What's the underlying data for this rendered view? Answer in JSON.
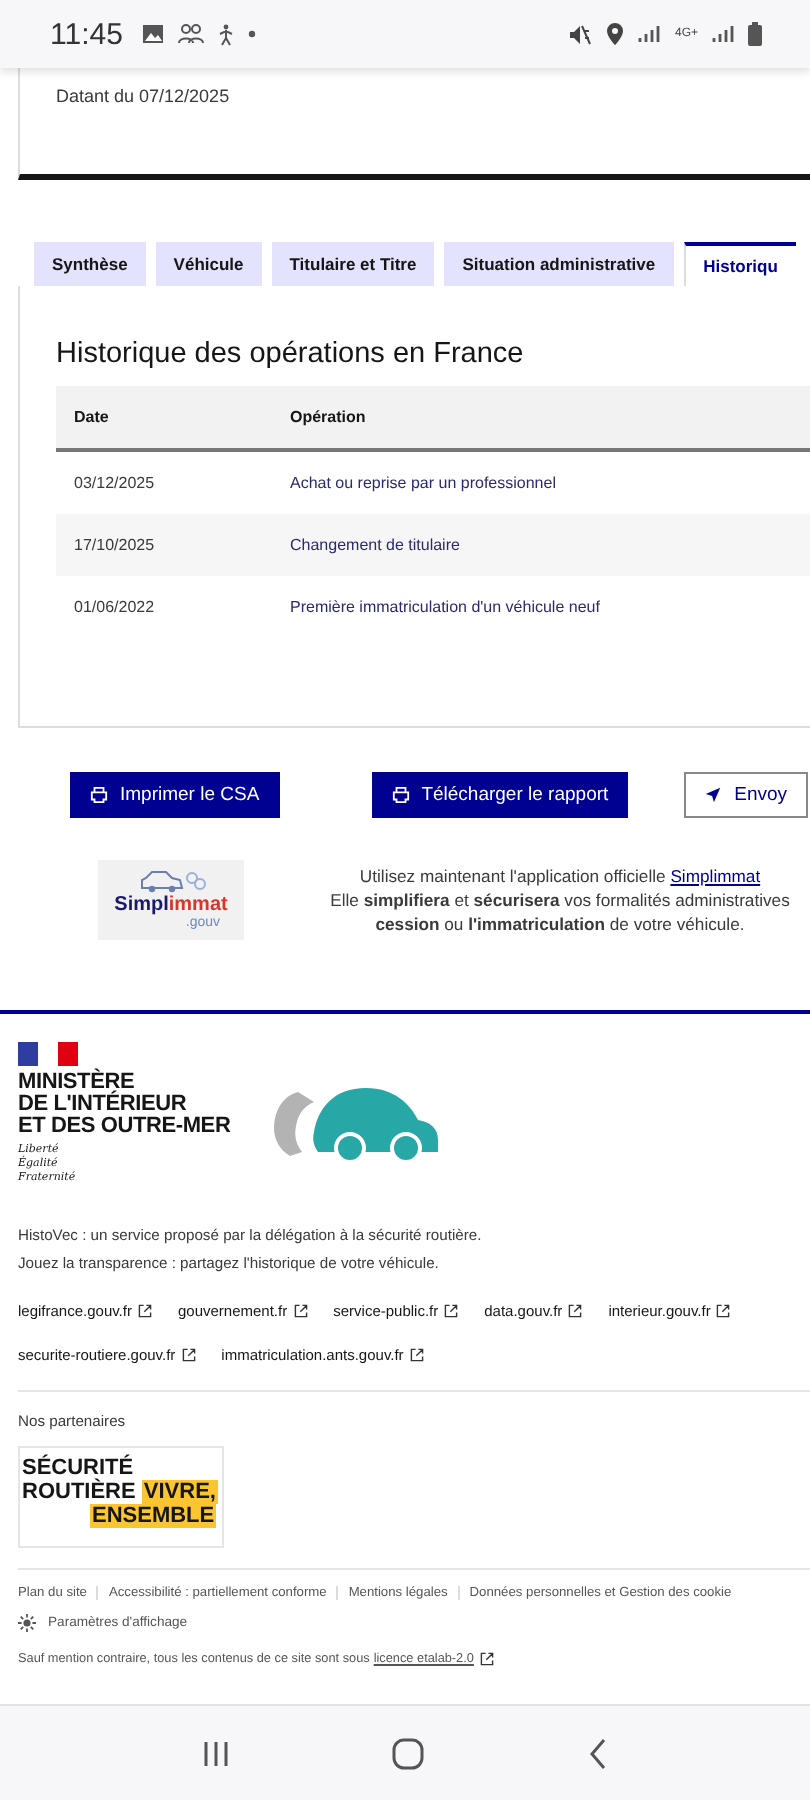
{
  "status_bar": {
    "time": "11:45",
    "network": "4G+"
  },
  "report_header": {
    "date_text": "Datant du 07/12/2025"
  },
  "tabs": [
    {
      "label": "Synthèse",
      "selected": false
    },
    {
      "label": "Véhicule",
      "selected": false
    },
    {
      "label": "Titulaire et Titre",
      "selected": false
    },
    {
      "label": "Situation administrative",
      "selected": false
    },
    {
      "label": "Historiqu",
      "selected": true
    }
  ],
  "history": {
    "title": "Historique des opérations en France",
    "columns": [
      "Date",
      "Opération"
    ],
    "rows": [
      {
        "date": "03/12/2025",
        "operation": "Achat ou reprise par un professionnel"
      },
      {
        "date": "17/10/2025",
        "operation": "Changement de titulaire"
      },
      {
        "date": "01/06/2022",
        "operation": "Première immatriculation d'un véhicule neuf"
      }
    ]
  },
  "actions": [
    {
      "label": "Imprimer le CSA",
      "kind": "print"
    },
    {
      "label": "Télécharger le rapport",
      "kind": "print"
    },
    {
      "label": "Envoy",
      "kind": "send"
    }
  ],
  "promo": {
    "logo": {
      "part_1": "Simpl",
      "part_2": "immat",
      "part_3": ".gouv"
    },
    "line_1": "Utilisez maintenant l'application officielle ",
    "link": "Simplimmat",
    "line_2": "Elle **simplifiera** et **sécurisera** vos formalités administratives",
    "line_3": "**cession** ou **l'immatriculation** de votre véhicule."
  },
  "footer": {
    "ministry": [
      "MINISTÈRE",
      "DE L'INTÉRIEUR",
      "ET DES OUTRE-MER"
    ],
    "motto": [
      "Liberté",
      "Égalité",
      "Fraternité"
    ],
    "description": [
      "HistoVec : un service proposé par la délégation à la sécurité routière.",
      "Jouez la transparence : partagez l'historique de votre véhicule."
    ],
    "links": [
      [
        "legifrance.gouv.fr",
        "gouvernement.fr",
        "service-public.fr",
        "data.gouv.fr",
        "interieur.gouv.fr"
      ],
      [
        "securite-routiere.gouv.fr",
        "immatriculation.ants.gouv.fr"
      ]
    ],
    "partners_title": "Nos partenaires",
    "partner_logo": {
      "line_1": "SÉCURITÉ",
      "line_2": "ROUTIÈRE",
      "highlight_1": "VIVRE,",
      "highlight_2": "ENSEMBLE"
    },
    "bottom_links": [
      "Plan du site",
      "Accessibilité : partiellement conforme",
      "Mentions légales",
      "Données personnelles et Gestion des cookie"
    ],
    "display_settings": "Paramètres d'affichage",
    "licence_text": "Sauf mention contraire, tous les contenus de ce site sont sous ",
    "licence_link": "licence etalab-2.0"
  }
}
